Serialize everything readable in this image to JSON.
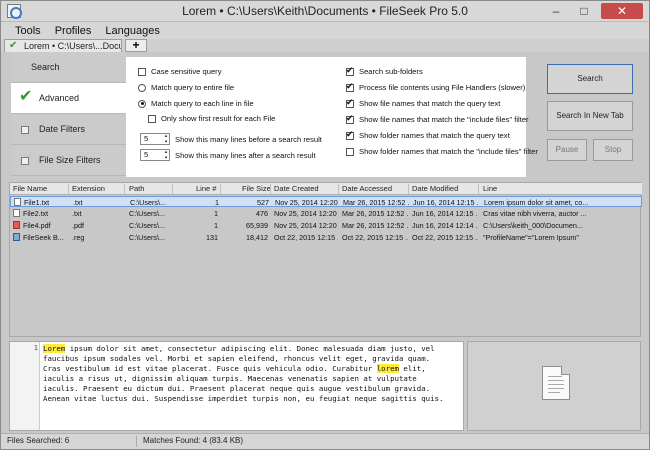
{
  "window": {
    "title": "Lorem • C:\\Users\\Keith\\Documents • FileSeek Pro 5.0",
    "controls": {
      "minimize": "–",
      "maximize": "□",
      "close": "✕"
    }
  },
  "menu": [
    "Tools",
    "Profiles",
    "Languages"
  ],
  "tabs": {
    "active_label": "Lorem • C:\\Users\\...Documents",
    "new_tab_label": "+"
  },
  "left_nav": {
    "items": [
      {
        "label": "Search"
      },
      {
        "label": "Advanced"
      },
      {
        "label": "Date Filters"
      },
      {
        "label": "File Size Filters"
      }
    ]
  },
  "advanced_options": {
    "case_sensitive": {
      "label": "Case sensitive query",
      "checked": false
    },
    "match_entire_file": {
      "label": "Match query to entire file",
      "selected": false
    },
    "match_each_line": {
      "label": "Match query to each line in file",
      "selected": true
    },
    "first_result_only": {
      "label": "Only show first result for each File",
      "checked": false
    },
    "lines_before": {
      "value": "5",
      "label": "Show this many lines before a search result"
    },
    "lines_after": {
      "value": "5",
      "label": "Show this many lines after a search result"
    },
    "search_subfolders": {
      "label": "Search sub-folders",
      "checked": true
    },
    "process_handlers": {
      "label": "Process file contents using File Handlers (slower)",
      "checked": true
    },
    "show_filenames_query": {
      "label": "Show file names that match the query text",
      "checked": true
    },
    "show_filenames_include": {
      "label": "Show file names that match the \"include files\" filter",
      "checked": true
    },
    "show_folders_query": {
      "label": "Show folder names that match the query text",
      "checked": true
    },
    "show_folders_include": {
      "label": "Show folder names that match the \"include files\" filter",
      "checked": false
    }
  },
  "buttons": {
    "search": "Search",
    "search_new_tab": "Search In New Tab",
    "pause": "Pause",
    "stop": "Stop"
  },
  "results": {
    "columns": [
      "File Name",
      "Extension",
      "Path",
      "Line #",
      "File Size",
      "Date Created",
      "Date Accessed",
      "Date Modified",
      "Line"
    ],
    "rows": [
      {
        "name": "File1.txt",
        "ext": ".txt",
        "path": "C:\\Users\\...",
        "line": "1",
        "size": "527",
        "created": "Nov 25, 2014 12:20 ...",
        "accessed": "Mar 26, 2015 12:52 ...",
        "modified": "Jun 16, 2014 12:15 ...",
        "text": "Lorem ipsum dolor sit amet, co...",
        "icon": "text-file-icon",
        "selected": true
      },
      {
        "name": "File2.txt",
        "ext": ".txt",
        "path": "C:\\Users\\...",
        "line": "1",
        "size": "476",
        "created": "Nov 25, 2014 12:20 ...",
        "accessed": "Mar 26, 2015 12:52 ...",
        "modified": "Jun 16, 2014 12:15 ...",
        "text": "Cras vitae nibh viverra, auctor ...",
        "icon": "text-file-icon",
        "selected": false
      },
      {
        "name": "File4.pdf",
        "ext": ".pdf",
        "path": "C:\\Users\\...",
        "line": "1",
        "size": "65,939",
        "created": "Nov 25, 2014 12:20 ...",
        "accessed": "Mar 26, 2015 12:52 ...",
        "modified": "Jun 16, 2014 12:14 ...",
        "text": "C:\\Users\\keith_000\\Documen...",
        "icon": "pdf-file-icon",
        "selected": false
      },
      {
        "name": "FileSeek B...",
        "ext": ".reg",
        "path": "C:\\Users\\...",
        "line": "131",
        "size": "18,412",
        "created": "Oct 22, 2015 12:15 ...",
        "accessed": "Oct 22, 2015 12:15 ...",
        "modified": "Oct 22, 2015 12:15 ...",
        "text": "\"ProfileName\"=\"Lorem Ipsum\"",
        "icon": "registry-file-icon",
        "selected": false
      }
    ]
  },
  "preview": {
    "line_number": "1",
    "lines": [
      [
        {
          "t": "Lorem",
          "hl": true
        },
        {
          "t": " ipsum dolor sit amet, consectetur adipiscing elit. Donec malesuada diam justo, vel"
        }
      ],
      [
        {
          "t": "faucibus ipsum sodales vel. Morbi et sapien eleifend, rhoncus velit eget, gravida quam."
        }
      ],
      [
        {
          "t": "Cras vestibulum id est vitae placerat. Fusce quis vehicula odio. Curabitur "
        },
        {
          "t": "lorem",
          "hl": true
        },
        {
          "t": " elit,"
        }
      ],
      [
        {
          "t": "iaculis a risus ut, dignissim aliquam turpis. Maecenas venenatis sapien at vulputate"
        }
      ],
      [
        {
          "t": "iaculis. Praesent eu dictum dui. Praesent placerat neque quis augue vestibulum gravida."
        }
      ],
      [
        {
          "t": "Aenean vitae luctus dui. Suspendisse imperdiet turpis non, eu feugiat neque sagittis quis."
        }
      ]
    ],
    "highlight_color": "#ffeb3b"
  },
  "status": {
    "files_searched": "Files Searched: 6",
    "matches_found": "Matches Found: 4 (83.4 KB)"
  },
  "colors": {
    "accent": "#3c6fb1",
    "check_green": "#2f9a2f",
    "selection": "#cfe0f7"
  }
}
